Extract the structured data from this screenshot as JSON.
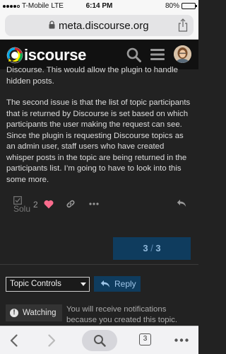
{
  "status_bar": {
    "carrier": "T-Mobile",
    "network": "LTE",
    "time": "6:14 PM",
    "battery": "80%",
    "battery_level": 0.8
  },
  "browser": {
    "url": "meta.discourse.org",
    "open_tabs": "3"
  },
  "header": {
    "logo_text": "iscourse",
    "icons": [
      "search-icon",
      "hamburger-menu-icon",
      "user-avatar"
    ]
  },
  "post": {
    "paragraph_1": "Discourse. This would allow the plugin to handle hidden posts.",
    "paragraph_2": "The second issue is that the list of topic participants that is returned by Discourse is set based on which participants the user making the request can see. Since the plugin is requesting Discourse topics as an admin user, staff users who have created whisper posts in the topic are being returned in the participants list. I’m going to have to look into this some more.",
    "actions": {
      "solution_label": "Solu",
      "like_count": "2"
    }
  },
  "progress": {
    "current": "3",
    "total": "3"
  },
  "footer": {
    "topic_controls_label": "Topic Controls",
    "reply_label": "Reply",
    "watching_label": "Watching",
    "watching_reason": "You will receive notifications because you created this topic."
  },
  "colors": {
    "background": "#222222",
    "header": "#111111",
    "accent": "#0f3c5e",
    "like": "#fa6c8d"
  }
}
